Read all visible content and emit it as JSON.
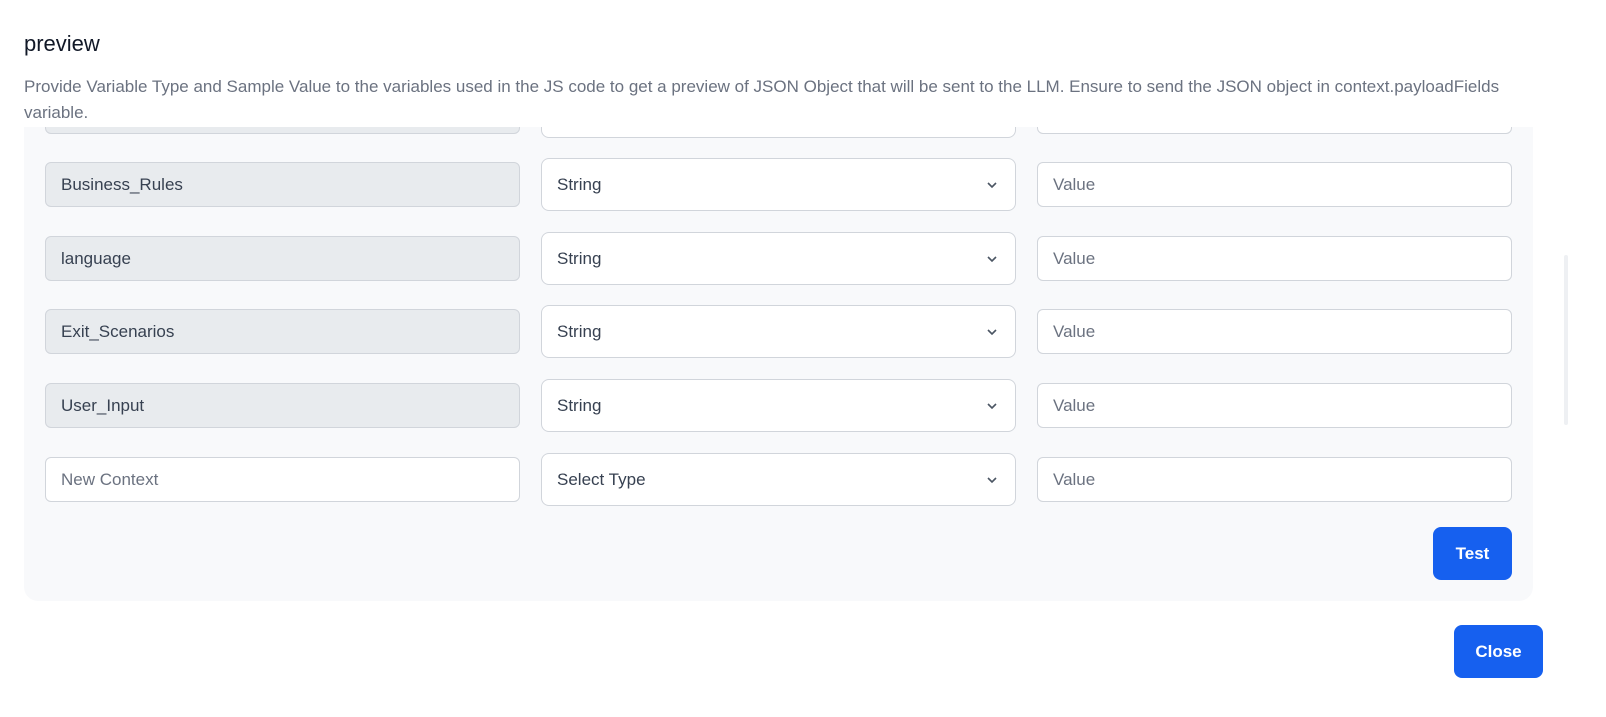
{
  "dialog": {
    "title": "preview",
    "description": "Provide Variable Type and Sample Value to the variables used in the JS code to get a preview of JSON Object that will be sent to the LLM. Ensure to send the JSON object in context.payloadFields variable."
  },
  "rows": [
    {
      "name": "",
      "type": "",
      "value_placeholder": ""
    },
    {
      "name": "Business_Rules",
      "type": "String",
      "value_placeholder": "Value"
    },
    {
      "name": "language",
      "type": "String",
      "value_placeholder": "Value"
    },
    {
      "name": "Exit_Scenarios",
      "type": "String",
      "value_placeholder": "Value"
    },
    {
      "name": "User_Input",
      "type": "String",
      "value_placeholder": "Value"
    }
  ],
  "new_row": {
    "name_placeholder": "New Context",
    "type": "Select Type",
    "value_placeholder": "Value"
  },
  "buttons": {
    "test": "Test",
    "close": "Close"
  },
  "colors": {
    "primary": "#1660ef",
    "panel": "#f8f9fb"
  }
}
